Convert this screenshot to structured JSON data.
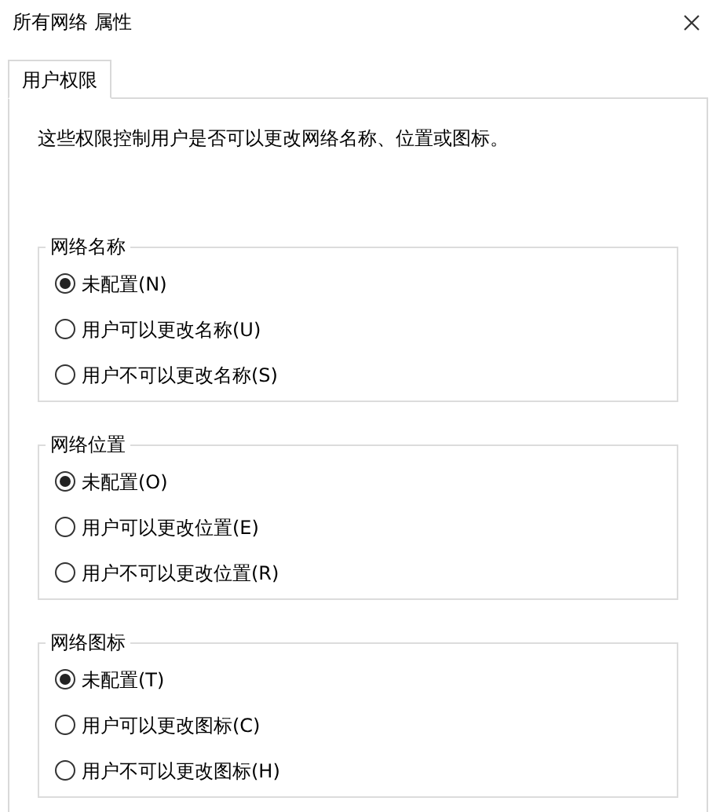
{
  "window": {
    "title": "所有网络 属性"
  },
  "tabs": [
    {
      "label": "用户权限",
      "selected": true
    }
  ],
  "description": "这些权限控制用户是否可以更改网络名称、位置或图标。",
  "groups": [
    {
      "title": "网络名称",
      "options": [
        {
          "label": "未配置(N)",
          "selected": true
        },
        {
          "label": "用户可以更改名称(U)",
          "selected": false
        },
        {
          "label": "用户不可以更改名称(S)",
          "selected": false
        }
      ]
    },
    {
      "title": "网络位置",
      "options": [
        {
          "label": "未配置(O)",
          "selected": true
        },
        {
          "label": "用户可以更改位置(E)",
          "selected": false
        },
        {
          "label": "用户不可以更改位置(R)",
          "selected": false
        }
      ]
    },
    {
      "title": "网络图标",
      "options": [
        {
          "label": "未配置(T)",
          "selected": true
        },
        {
          "label": "用户可以更改图标(C)",
          "selected": false
        },
        {
          "label": "用户不可以更改图标(H)",
          "selected": false
        }
      ]
    }
  ]
}
